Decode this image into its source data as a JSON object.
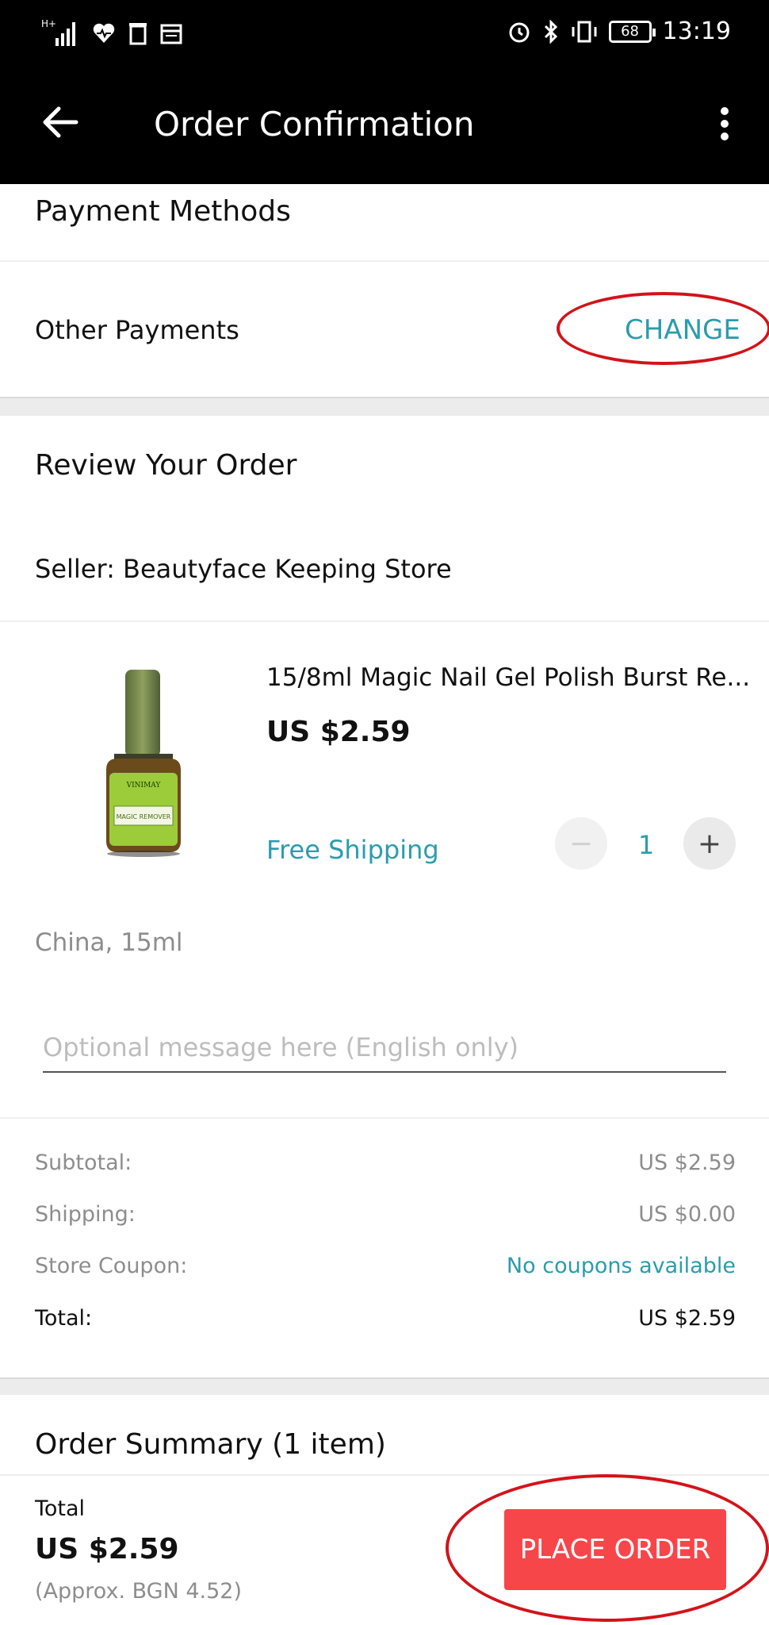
{
  "status_bar": {
    "network": "H+",
    "battery": "68",
    "time": "13:19"
  },
  "header": {
    "title": "Order Confirmation"
  },
  "payment": {
    "section_title": "Payment Methods",
    "method_label": "Other Payments",
    "change_label": "CHANGE"
  },
  "review": {
    "section_title": "Review Your Order",
    "seller": "Seller: Beautyface Keeping Store",
    "product": {
      "name": "15/8ml Magic Nail Gel Polish Burst Re...",
      "price": "US $2.59",
      "shipping": "Free Shipping",
      "quantity": "1",
      "variant": "China, 15ml",
      "image_brand": "VINIMAY",
      "image_label": "MAGIC REMOVER"
    },
    "message_placeholder": "Optional message here (English only)"
  },
  "summary": {
    "subtotal_label": "Subtotal:",
    "subtotal_value": "US $2.59",
    "shipping_label": "Shipping:",
    "shipping_value": "US $0.00",
    "coupon_label": "Store Coupon:",
    "coupon_value": "No coupons available",
    "total_label": "Total:",
    "total_value": "US $2.59"
  },
  "order_summary": {
    "title": "Order Summary (1 item)"
  },
  "footer": {
    "total_label": "Total",
    "total_value": "US $2.59",
    "approx": "(Approx. BGN 4.52)",
    "place_order_label": "PLACE ORDER"
  },
  "colors": {
    "accent": "#2b9cad",
    "button": "#f7464a",
    "annotation": "#d3131a"
  }
}
